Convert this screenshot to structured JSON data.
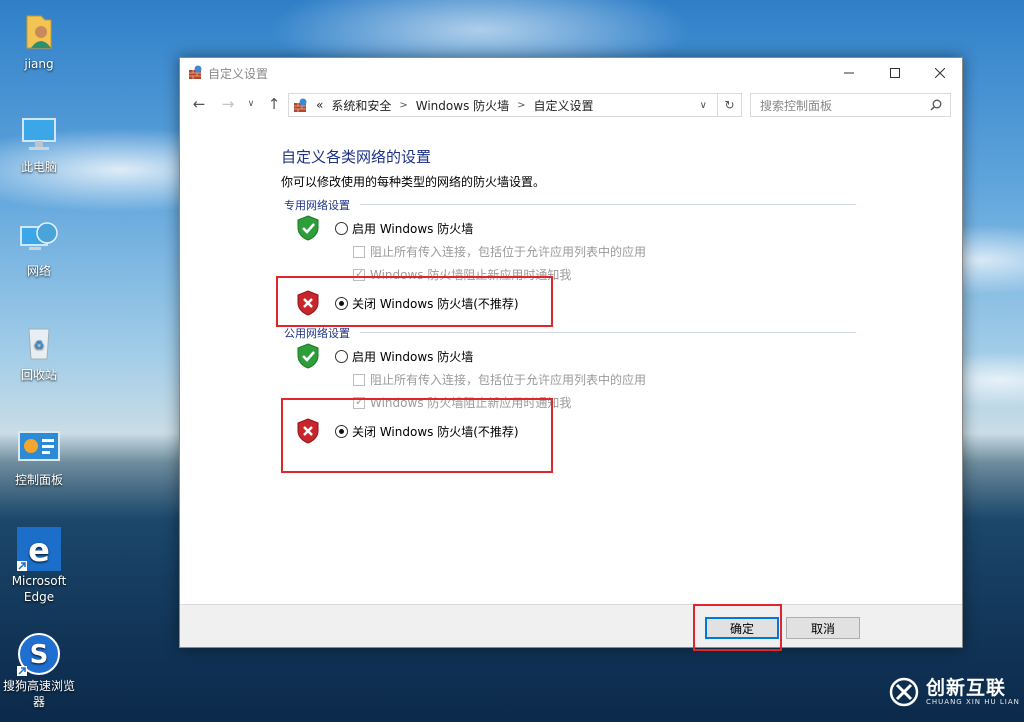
{
  "desktop": {
    "icons": [
      {
        "label": "jiang",
        "icon": "user-folder-icon"
      },
      {
        "label": "此电脑",
        "icon": "this-pc-icon"
      },
      {
        "label": "网络",
        "icon": "network-icon"
      },
      {
        "label": "回收站",
        "icon": "recycle-bin-icon"
      },
      {
        "label": "控制面板",
        "icon": "control-panel-icon"
      },
      {
        "label_line1": "Microsoft",
        "label_line2": "Edge",
        "icon": "edge-icon"
      },
      {
        "label_line1": "搜狗高速浏览",
        "label_line2": "器",
        "icon": "sogou-browser-icon"
      }
    ]
  },
  "window": {
    "title": "自定义设置",
    "breadcrumb": {
      "overflow": "«",
      "items": [
        "系统和安全",
        "Windows 防火墙",
        "自定义设置"
      ]
    },
    "search": {
      "placeholder": "搜索控制面板"
    },
    "heading": "自定义各类网络的设置",
    "description": "你可以修改使用的每种类型的网络的防火墙设置。",
    "private": {
      "label": "专用网络设置",
      "enable_label": "启用 Windows 防火墙",
      "block_all_label": "阻止所有传入连接，包括位于允许应用列表中的应用",
      "notify_label": "Windows 防火墙阻止新应用时通知我",
      "disable_label": "关闭 Windows 防火墙(不推荐)",
      "selected": "disable"
    },
    "public": {
      "label": "公用网络设置",
      "enable_label": "启用 Windows 防火墙",
      "block_all_label": "阻止所有传入连接，包括位于允许应用列表中的应用",
      "notify_label": "Windows 防火墙阻止新应用时通知我",
      "disable_label": "关闭 Windows 防火墙(不推荐)",
      "selected": "disable"
    },
    "buttons": {
      "ok": "确定",
      "cancel": "取消"
    }
  },
  "watermark": {
    "title": "创新互联",
    "subtitle": "CHUANG XIN HU LIAN"
  },
  "colors": {
    "accent_blue": "#1e3287",
    "highlight_red": "#e0262a",
    "shield_green": "#2e9e3a",
    "shield_red": "#c8262c"
  }
}
